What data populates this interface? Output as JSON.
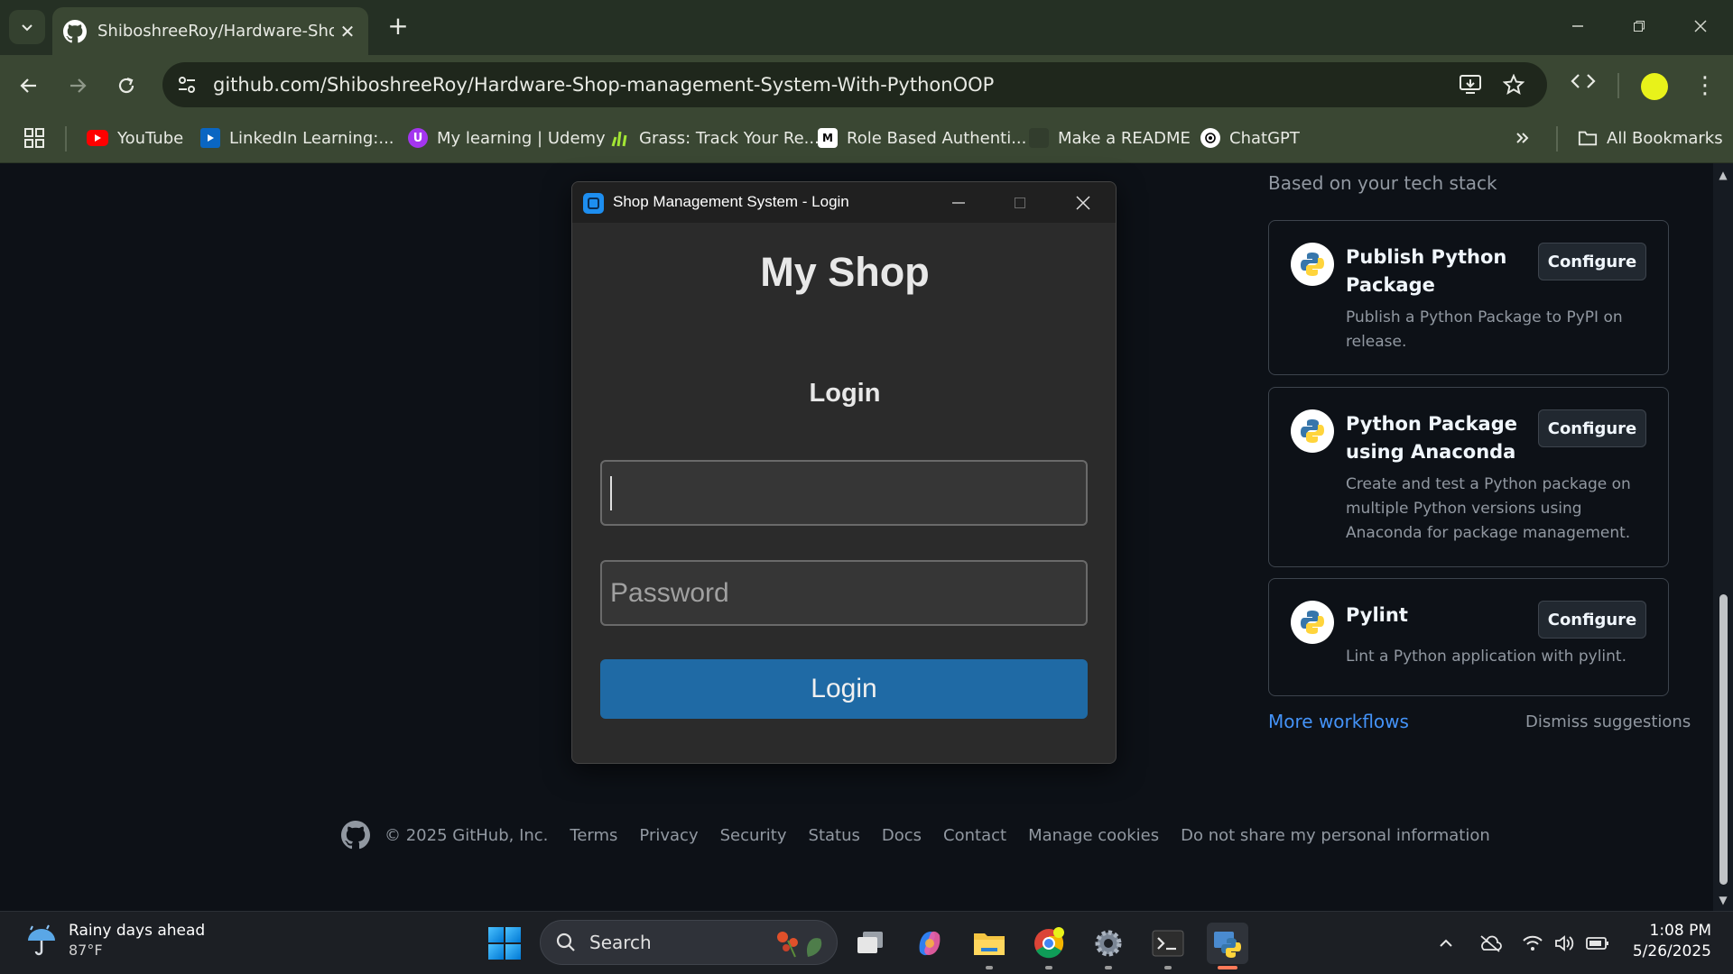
{
  "browser": {
    "tab_title": "ShiboshreeRoy/Hardware-Shop-management-System-With-PythonOOP",
    "url": "github.com/ShiboshreeRoy/Hardware-Shop-management-System-With-PythonOOP",
    "bookmarks": [
      {
        "label": "YouTube",
        "icon": "youtube-icon",
        "color": "#ff0000"
      },
      {
        "label": "LinkedIn Learning:...",
        "icon": "linkedin-learning-icon",
        "color": "#0a66c2"
      },
      {
        "label": "My learning | Udemy",
        "icon": "udemy-icon",
        "color": "#a435f0"
      },
      {
        "label": "Grass: Track Your Re...",
        "icon": "grass-icon",
        "color": "#a3e635"
      },
      {
        "label": "Role Based Authenti...",
        "icon": "medium-icon",
        "color": "#ffffff"
      },
      {
        "label": "Make a README",
        "icon": "readme-icon",
        "color": "#3a4733"
      },
      {
        "label": "ChatGPT",
        "icon": "chatgpt-icon",
        "color": "#ffffff"
      }
    ],
    "all_bookmarks": "All Bookmarks"
  },
  "sidebar": {
    "header": "Based on your tech stack",
    "cards": [
      {
        "title": "Publish Python Package",
        "description": "Publish a Python Package to PyPI on release.",
        "button": "Configure"
      },
      {
        "title": "Python Package using Anaconda",
        "description": "Create and test a Python package on multiple Python versions using Anaconda for package management.",
        "button": "Configure"
      },
      {
        "title": "Pylint",
        "description": "Lint a Python application with pylint.",
        "button": "Configure"
      }
    ],
    "more_workflows": "More workflows",
    "dismiss": "Dismiss suggestions"
  },
  "footer": {
    "copyright": "© 2025 GitHub, Inc.",
    "links": [
      "Terms",
      "Privacy",
      "Security",
      "Status",
      "Docs",
      "Contact",
      "Manage cookies",
      "Do not share my personal information"
    ]
  },
  "dialog": {
    "window_title": "Shop Management System - Login",
    "heading": "My Shop",
    "subheading": "Login",
    "username_value": "",
    "password_placeholder": "Password",
    "login_button": "Login"
  },
  "taskbar": {
    "weather_text": "Rainy days ahead",
    "temperature": "87°F",
    "search_label": "Search",
    "time": "1:08 PM",
    "date": "5/26/2025"
  },
  "colors": {
    "github_bg": "#0d1117",
    "link_blue": "#4493f8",
    "login_button": "#1f6aa5",
    "chrome_theme": "#3a4733"
  }
}
